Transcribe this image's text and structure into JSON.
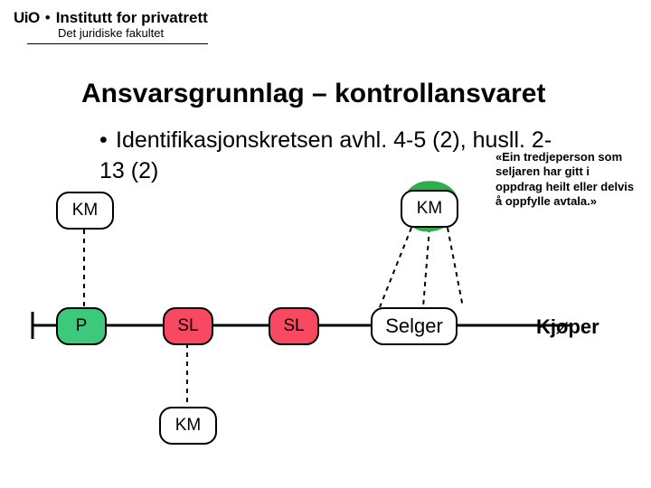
{
  "header": {
    "uio": "UiO",
    "separator": "•",
    "institute": "Institutt for privatrett",
    "faculty": "Det juridiske fakultet"
  },
  "slide": {
    "title": "Ansvarsgrunnlag – kontrollansvaret",
    "bullet": "Identifikasjonskretsen avhl. 4-5 (2), husll. 2-13 (2)",
    "quote": "«Ein tredjeperson som seljaren har gitt i oppdrag heilt eller delvis å oppfylle avtala.»"
  },
  "nodes": {
    "km_top_left": "KM",
    "km_top_right": "KM",
    "p": "P",
    "sl_1": "SL",
    "sl_2": "SL",
    "selger": "Selger",
    "km_bottom": "KM",
    "kjoper": "Kjøper"
  }
}
